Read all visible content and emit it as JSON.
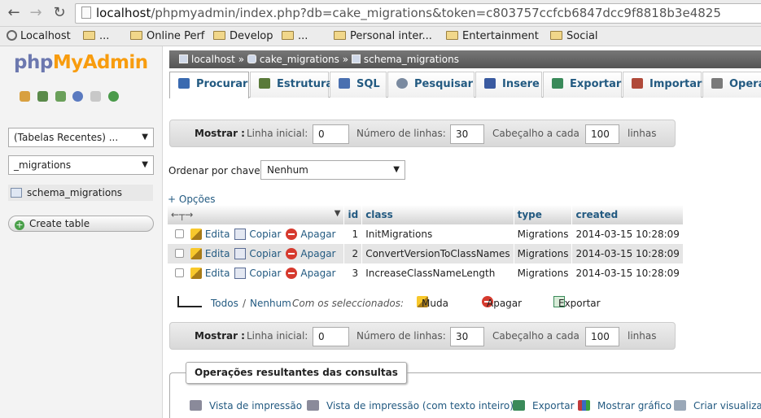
{
  "browser": {
    "url_host": "localhost",
    "url_rest": "/phpmyadmin/index.php?db=cake_migrations&token=c803757ccfcb6847dcc9f8818b3e4825",
    "bookmarks": [
      "Localhost",
      "...",
      "Online Perf",
      "Develop",
      "...",
      "Personal inter...",
      "Entertainment",
      "Social"
    ]
  },
  "nav": {
    "logo_php": "php",
    "logo_myadmin": "MyAdmin",
    "recent_tables": "(Tabelas Recentes) ...",
    "database": "_migrations",
    "table": "schema_migrations",
    "create_table": "Create table"
  },
  "breadcrumb": {
    "server": "localhost",
    "sep": "»",
    "db": "cake_migrations",
    "table": "schema_migrations"
  },
  "tabs": [
    {
      "label": "Procurar",
      "color": "#3a6ab0"
    },
    {
      "label": "Estrutura",
      "color": "#5a7a3a"
    },
    {
      "label": "SQL",
      "color": "#4a70b0"
    },
    {
      "label": "Pesquisar",
      "color": "#7a8aa0"
    },
    {
      "label": "Insere",
      "color": "#3a5aa0"
    },
    {
      "label": "Exportar",
      "color": "#3a8a5a"
    },
    {
      "label": "Importar",
      "color": "#b04a3a"
    },
    {
      "label": "Operações",
      "color": "#7a7a7a"
    }
  ],
  "navigation": {
    "show_label": "Mostrar :",
    "start_label": "Linha inicial:",
    "start_value": "0",
    "rows_label": "Número de linhas:",
    "rows_value": "30",
    "header_label": "Cabeçalho a cada",
    "header_value": "100",
    "lines_label": "linhas"
  },
  "sort": {
    "label": "Ordenar por chave:",
    "value": "Nenhum"
  },
  "options_link": "+ Opções",
  "columns": [
    "id",
    "class",
    "type",
    "created"
  ],
  "actions": {
    "edit": "Edita",
    "copy": "Copiar",
    "delete": "Apagar"
  },
  "rows": [
    {
      "id": "1",
      "class": "InitMigrations",
      "type": "Migrations",
      "created": "2014-03-15 10:28:09"
    },
    {
      "id": "2",
      "class": "ConvertVersionToClassNames",
      "type": "Migrations",
      "created": "2014-03-15 10:28:09"
    },
    {
      "id": "3",
      "class": "IncreaseClassNameLength",
      "type": "Migrations",
      "created": "2014-03-15 10:28:09"
    }
  ],
  "bulk": {
    "all": "Todos",
    "slash": "/",
    "none": "Nenhum",
    "with_selected": "Com os seleccionados:",
    "change": "Muda",
    "delete": "Apagar",
    "export": "Exportar"
  },
  "query_ops": {
    "legend": "Operações resultantes das consultas",
    "print_view": "Vista de impressão",
    "print_view_full": "Vista de impressão (com texto inteiro)",
    "export": "Exportar",
    "chart": "Mostrar gráfico",
    "create_view": "Criar visualização"
  }
}
